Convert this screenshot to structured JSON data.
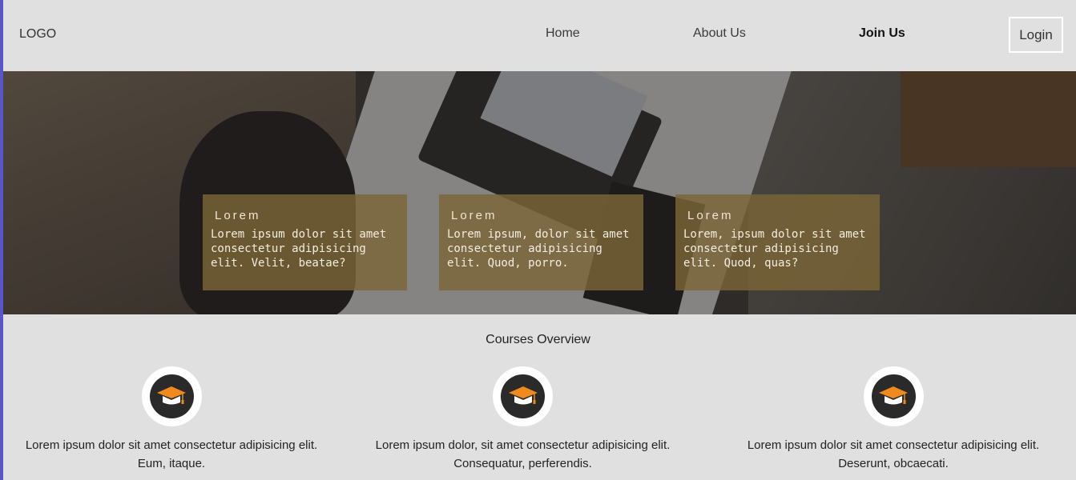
{
  "nav": {
    "logo": "LOGO",
    "links": [
      "Home",
      "About Us",
      "Join Us"
    ],
    "login_label": "Login"
  },
  "hero": {
    "cards": [
      {
        "title": "Lorem",
        "text": "Lorem ipsum dolor sit amet consectetur adipisicing elit. Velit, beatae?"
      },
      {
        "title": "Lorem",
        "text": "Lorem ipsum, dolor sit amet consectetur adipisicing elit. Quod, porro."
      },
      {
        "title": "Lorem",
        "text": "Lorem, ipsum dolor sit amet consectetur adipisicing elit. Quod, quas?"
      }
    ]
  },
  "courses": {
    "title": "Courses Overview",
    "icon": "graduation-cap-icon",
    "accent": "#f08a1c",
    "items": [
      {
        "text": "Lorem ipsum dolor sit amet consectetur adipisicing elit. Eum, itaque."
      },
      {
        "text": "Lorem ipsum dolor, sit amet consectetur adipisicing elit. Consequatur, perferendis."
      },
      {
        "text": "Lorem ipsum dolor sit amet consectetur adipisicing elit. Deserunt, obcaecati."
      }
    ]
  }
}
